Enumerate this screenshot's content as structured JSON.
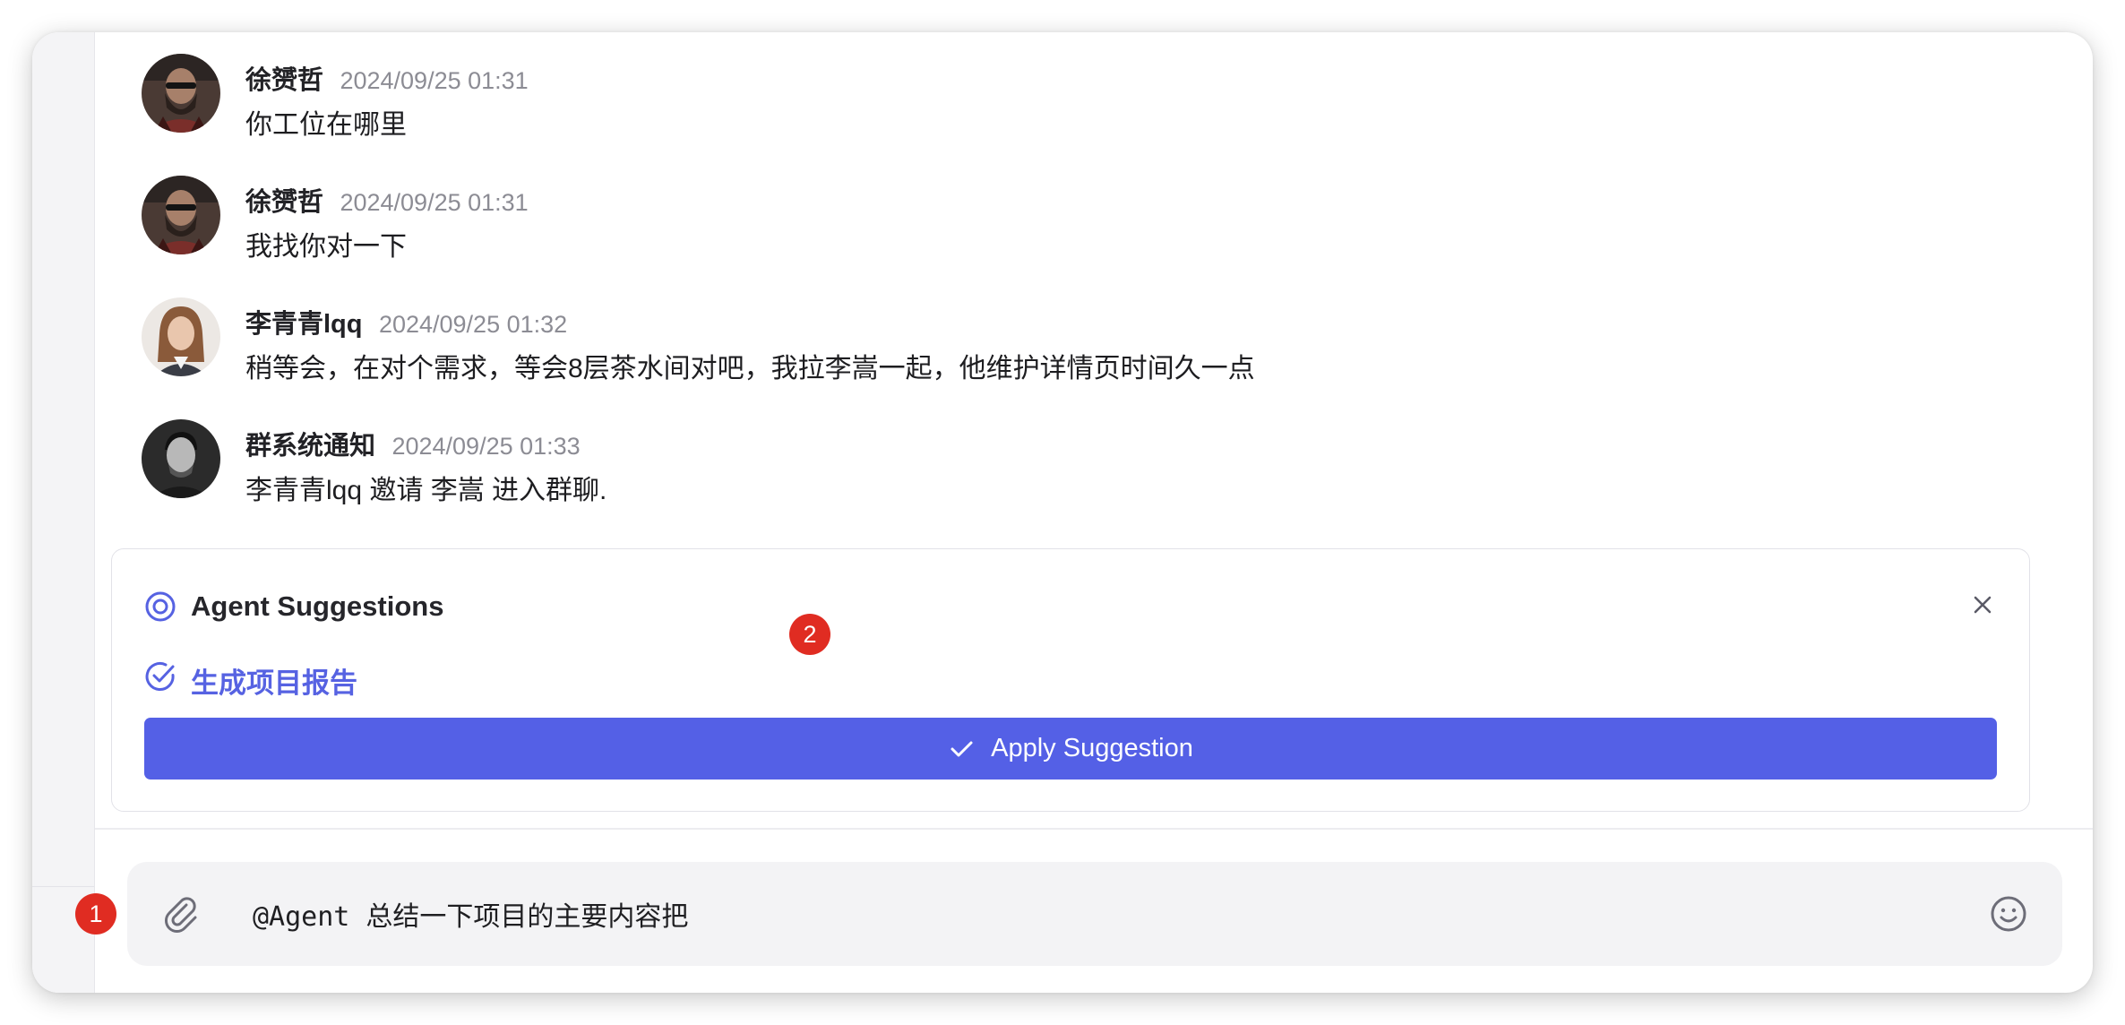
{
  "messages": [
    {
      "sender": "徐赟哲",
      "time": "2024/09/25 01:31",
      "text": "你工位在哪里",
      "avatar": "avatar-man-beard"
    },
    {
      "sender": "徐赟哲",
      "time": "2024/09/25 01:31",
      "text": "我找你对一下",
      "avatar": "avatar-man-beard"
    },
    {
      "sender": "李青青lqq",
      "time": "2024/09/25 01:32",
      "text": "稍等会，在对个需求，等会8层茶水间对吧，我拉李嵩一起，他维护详情页时间久一点",
      "avatar": "avatar-woman"
    },
    {
      "sender": "群系统通知",
      "time": "2024/09/25 01:33",
      "text": "李青青lqq 邀请 李嵩 进入群聊.",
      "avatar": "avatar-man-bw"
    }
  ],
  "suggestions": {
    "title": "Agent Suggestions",
    "header_icon": "target-icon",
    "item_label": "生成项目报告",
    "item_icon": "check-circle-icon",
    "apply_label": "Apply Suggestion",
    "close_icon": "close-icon"
  },
  "composer": {
    "value": "@Agent 总结一下项目的主要内容把",
    "attach_icon": "paperclip-icon",
    "emoji_icon": "smiley-icon"
  },
  "badges": {
    "one": "1",
    "two": "2"
  },
  "colors": {
    "accent": "#5460e6",
    "accent_text": "#5662e2",
    "badge": "#e02c22",
    "timestamp": "#8c8c94"
  }
}
